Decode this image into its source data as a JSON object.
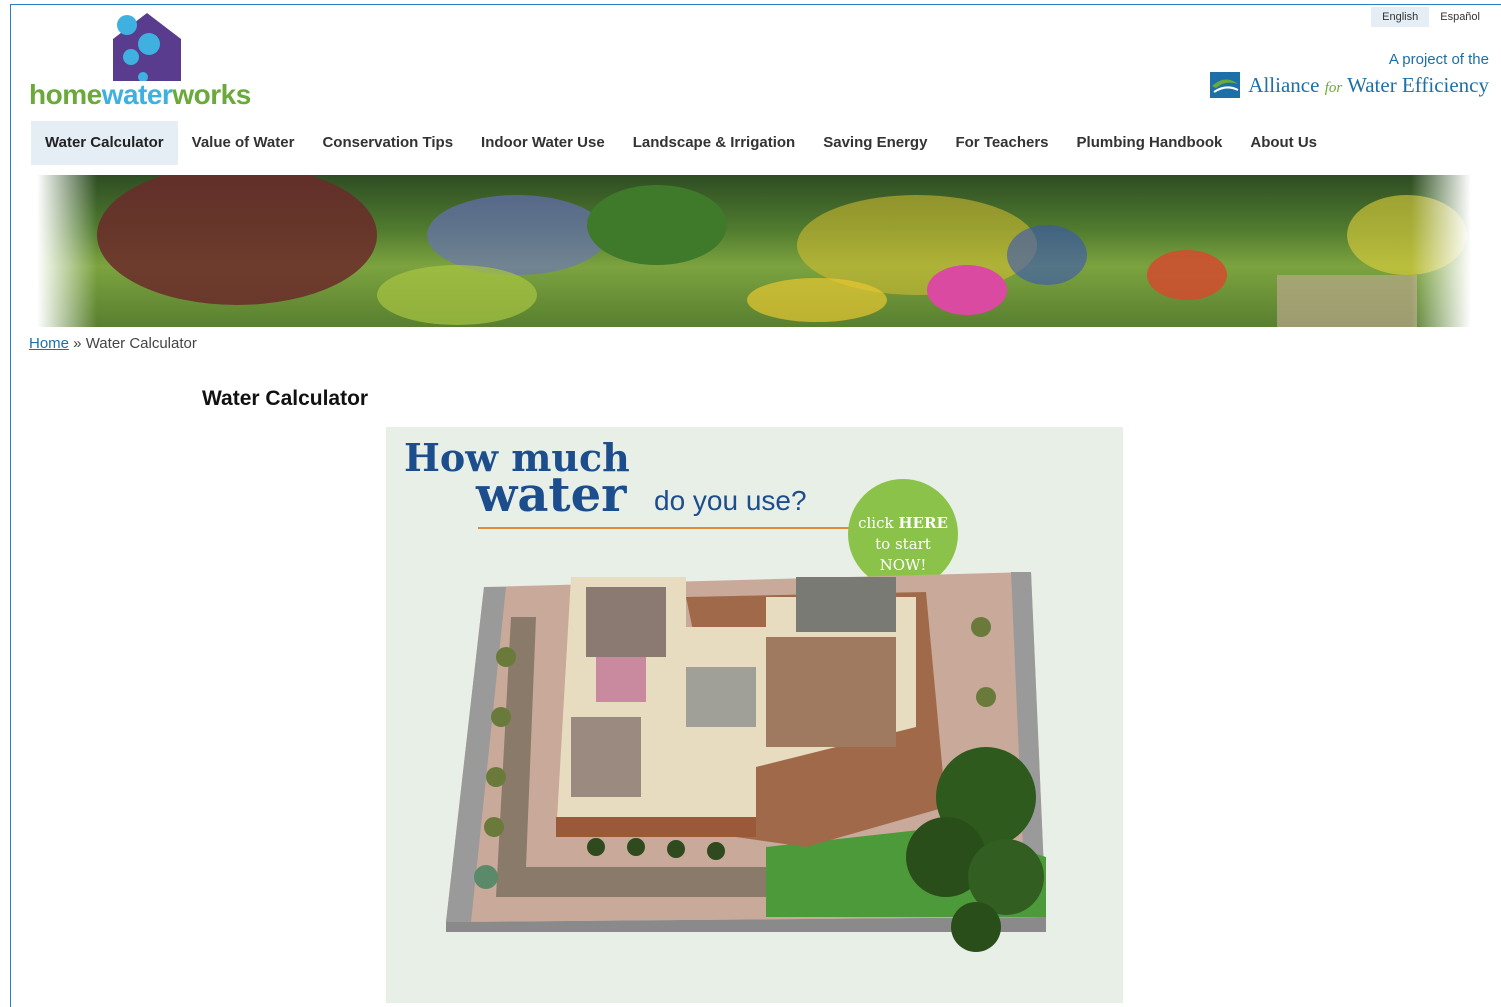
{
  "lang": {
    "english": "English",
    "espanol": "Español"
  },
  "logo": {
    "part1": "home",
    "part2": "water",
    "part3": "works"
  },
  "alliance": {
    "project": "A project of the",
    "name_a": "Alliance ",
    "name_for": "for",
    "name_b": " Water Efficiency"
  },
  "nav": [
    "Water Calculator",
    "Value of Water",
    "Conservation Tips",
    "Indoor Water Use",
    "Landscape & Irrigation",
    "Saving Energy",
    "For Teachers",
    "Plumbing Handbook",
    "About Us"
  ],
  "breadcrumb": {
    "home": "Home",
    "sep": " » ",
    "current": "Water Calculator"
  },
  "page_title": "Water Calculator",
  "promo": {
    "line1": "How much",
    "line2": "water",
    "line3": "do you use?",
    "cta_click": "click ",
    "cta_here": "HERE",
    "cta_start": "to start",
    "cta_now": "NOW!"
  },
  "colors": {
    "brand_blue": "#1d6fa8",
    "brand_green": "#6aa93a",
    "cta_green": "#8bc34a",
    "nav_active": "#e6eef5"
  }
}
